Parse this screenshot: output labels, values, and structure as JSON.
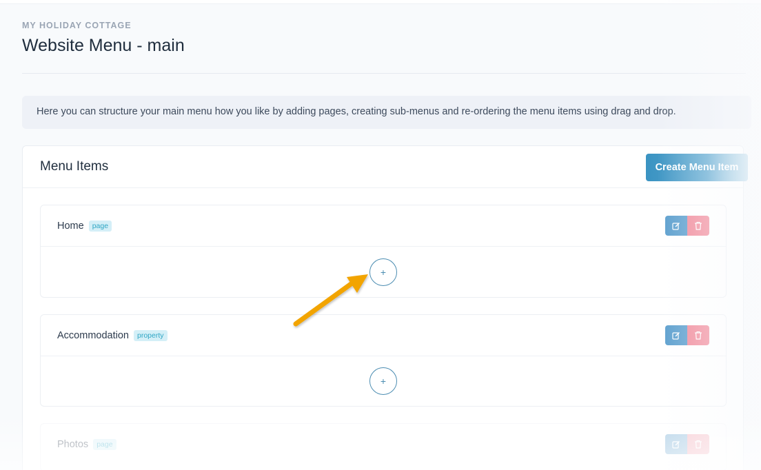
{
  "header": {
    "eyebrow": "MY HOLIDAY COTTAGE",
    "title": "Website Menu - main"
  },
  "info": {
    "text": "Here you can structure your main menu how you like by adding pages, creating sub-menus and re-ordering the menu items using drag and drop."
  },
  "card": {
    "title": "Menu Items",
    "create_label": "Create Menu Item"
  },
  "menu_items": [
    {
      "label": "Home",
      "badge": "page",
      "add_label": "+"
    },
    {
      "label": "Accommodation",
      "badge": "property",
      "add_label": "+"
    },
    {
      "label": "Photos",
      "badge": "page"
    }
  ],
  "icons": {
    "edit": "edit-icon",
    "delete": "trash-icon",
    "add": "plus-icon",
    "annotation": "arrow-annotation-icon"
  },
  "colors": {
    "accent": "#3a93c2",
    "edit": "#5c9fce",
    "delete": "#f18b9b",
    "badge_bg": "#d4eff7",
    "badge_text": "#2fa6c4",
    "arrow": "#f2a400"
  }
}
